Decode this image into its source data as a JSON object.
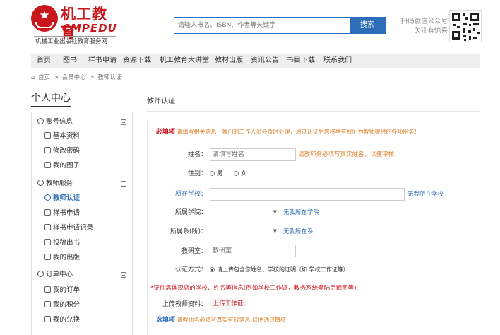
{
  "logo": {
    "cn": "机工教育",
    "en": "CMPEDU",
    "sub": "机械工业出版社教育服务网"
  },
  "search": {
    "placeholder": "请输入书名、ISBN、作者等关键字",
    "button": "搜索"
  },
  "wechat": {
    "line1": "扫码微信公众号",
    "line2": "关注有惊喜"
  },
  "nav": [
    "首页",
    "图书",
    "样书申请",
    "资源下载",
    "机工教育大讲堂",
    "教材出版",
    "资讯公告",
    "书目下载",
    "联系我们"
  ],
  "breadcrumb": [
    "首页",
    ">",
    "会员中心",
    ">",
    "教师认证"
  ],
  "sidebar": {
    "title": "个人中心",
    "groups": [
      {
        "label": "账号信息",
        "items": [
          "基本资料",
          "修改密码",
          "我的圈子"
        ]
      },
      {
        "label": "教师服务",
        "items": [
          "教师认证",
          "样书申请",
          "样书申请记录",
          "投稿出书",
          "我的出版"
        ]
      },
      {
        "label": "订单中心",
        "items": [
          "我的订单",
          "我的积分",
          "我的兑换"
        ]
      }
    ]
  },
  "main": {
    "title": "教师认证",
    "notice_bold": "必填项",
    "notice_text": "请填写相关信息，我们的工作人员会及时处理，通过认证后您将享有我们为教师提供的各项服务！",
    "fields": {
      "name_label": "姓名：",
      "name_placeholder": "请填写姓名",
      "name_hint": "请教师务必填写真实姓名，以便审核",
      "gender_label": "性别：",
      "gender_male": "男",
      "gender_female": "女",
      "school_label": "所在学校：",
      "school_link": "无我所在学校",
      "college_label": "所属学院：",
      "college_link": "无我所在学院",
      "dept_label": "所属系(所)：",
      "dept_link": "无我所在系",
      "office_label": "教研室：",
      "office_placeholder": "教研室",
      "method_label": "认证方式：",
      "method_option": "请上传包含您姓名、学校的证明（如:学校工作证等）",
      "warning": "*证件需体现您的学校、姓名等信息(例如学校工作证，教务系统登陆后截图等)",
      "upload_label": "上传教师资料：",
      "upload_button": "上传工作证"
    },
    "optional_bold": "选填项",
    "optional_text": "请教师务必填写真实有效信息,以便通过审核"
  }
}
